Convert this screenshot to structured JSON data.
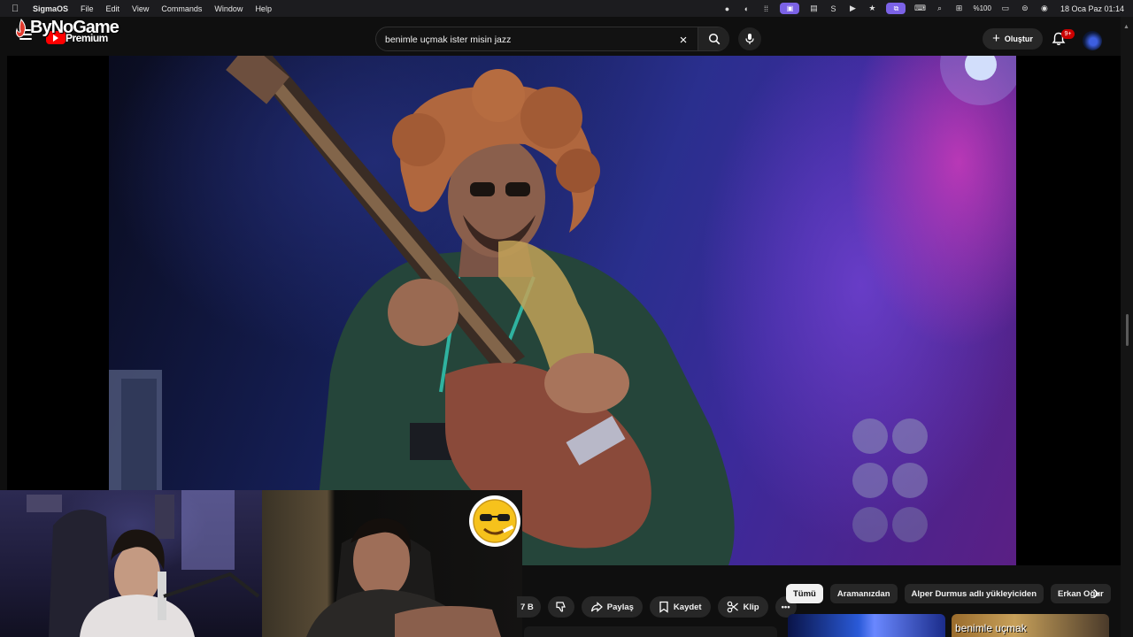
{
  "menubar": {
    "app_name": "SigmaOS",
    "menus": [
      "File",
      "Edit",
      "View",
      "Commands",
      "Window",
      "Help"
    ],
    "battery": "%100",
    "datetime": "18 Oca Paz  01:14"
  },
  "overlay_logo": {
    "text": "ByNoGame"
  },
  "header": {
    "premium_label": "Premium",
    "search_query": "benimle uçmak ister misin jazz",
    "create_label": "Oluştur",
    "notification_count": "9+"
  },
  "actions": {
    "likes_partial": "7 B",
    "share_label": "Paylaş",
    "save_label": "Kaydet",
    "clip_label": "Klip"
  },
  "chips": [
    "Tümü",
    "Aramanızdan",
    "Alper Durmus adlı yükleyiciden",
    "Erkan Oğur"
  ],
  "recommended": {
    "thumb2_caption": "benimle uçmak"
  },
  "colors": {
    "brand_red": "#ff0000",
    "accent_purple": "#7b62e6",
    "chip_active_bg": "#f1f1f1"
  }
}
